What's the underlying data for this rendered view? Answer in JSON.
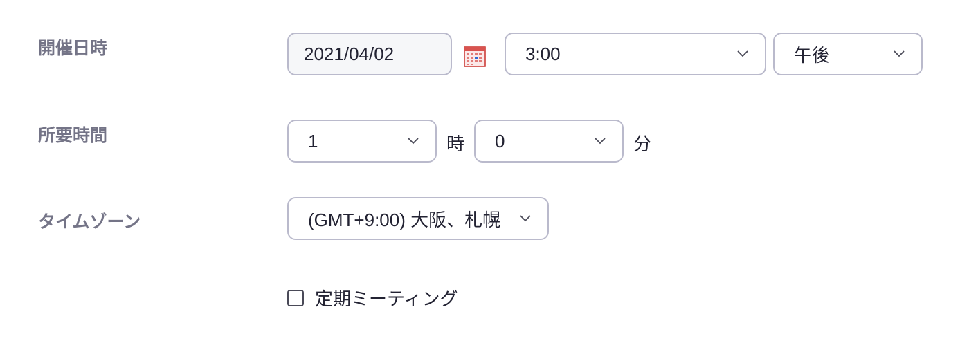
{
  "schedule": {
    "datetime": {
      "label": "開催日時",
      "date_value": "2021/04/02",
      "calendar_icon": "calendar-icon",
      "time_value": "3:00",
      "ampm_value": "午後"
    },
    "duration": {
      "label": "所要時間",
      "hours_value": "1",
      "hours_unit": "時",
      "minutes_value": "0",
      "minutes_unit": "分"
    },
    "timezone": {
      "label": "タイムゾーン",
      "value": "(GMT+9:00) 大阪、札幌"
    },
    "recurring": {
      "label": "定期ミーティング",
      "checked": false
    }
  },
  "colors": {
    "label_text": "#747487",
    "body_text": "#232333",
    "field_border": "#babacc",
    "input_background": "#f6f7f9",
    "calendar_accent": "#d9534f"
  }
}
